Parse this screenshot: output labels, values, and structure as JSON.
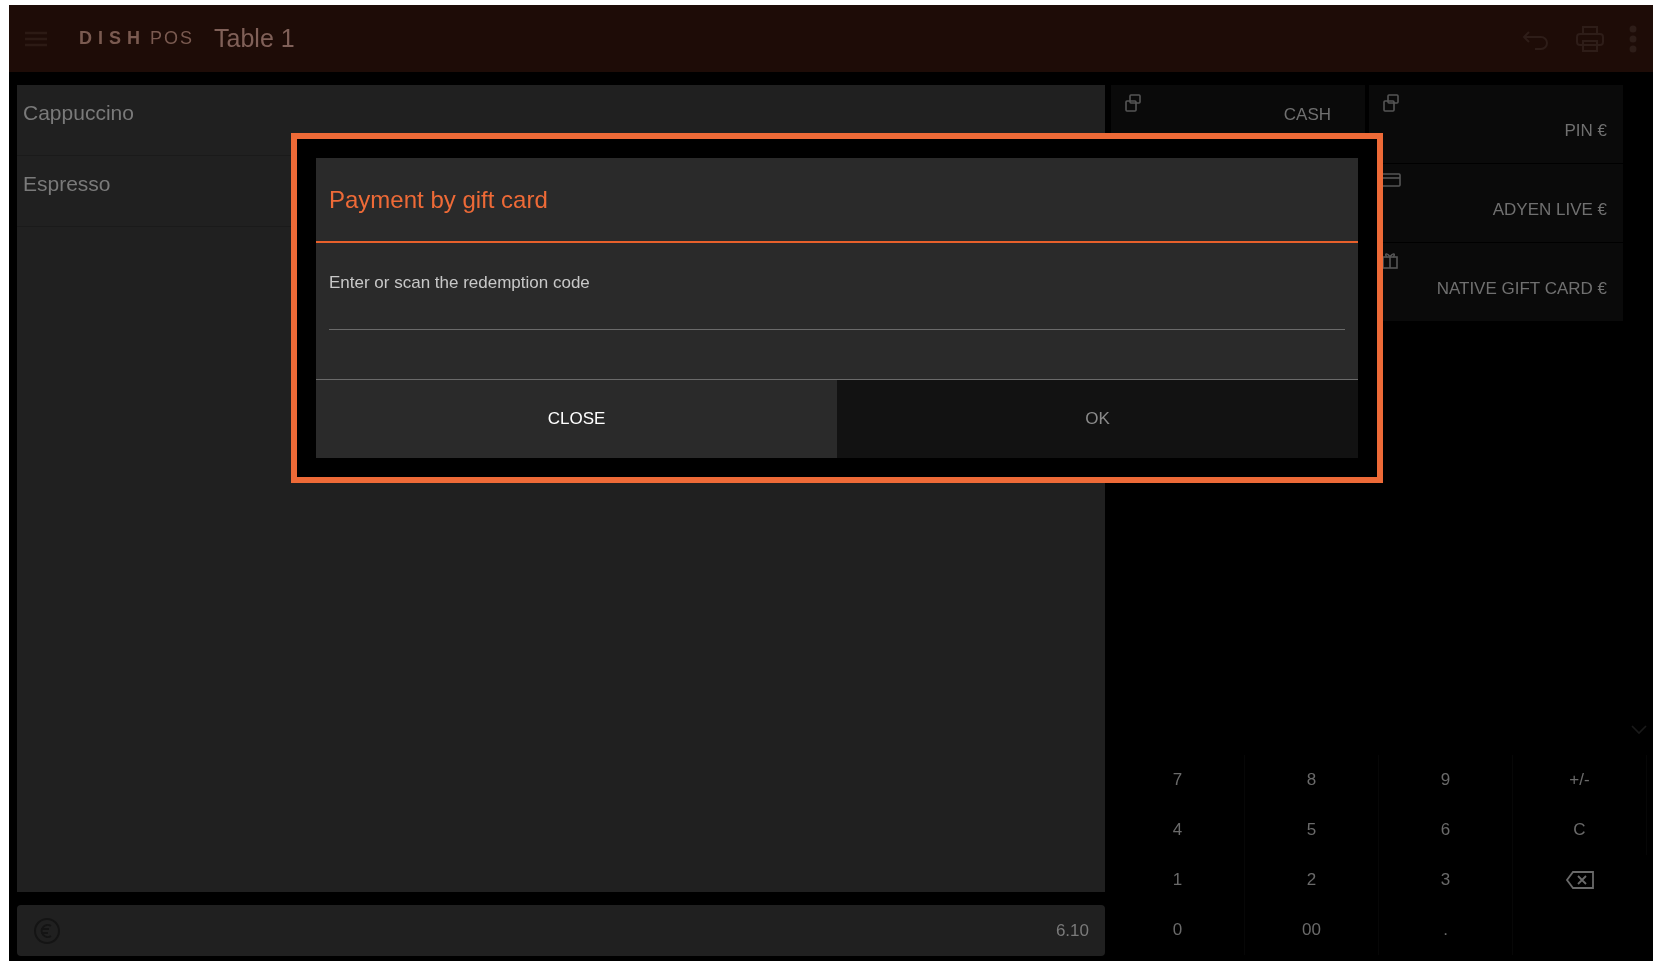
{
  "app_bar": {
    "brand": "DISH",
    "brand_suffix": "POS",
    "title": "Table 1"
  },
  "order_items": [
    {
      "name": "Cappuccino"
    },
    {
      "name": "Espresso"
    }
  ],
  "total": {
    "amount": "6.10"
  },
  "payment_methods": [
    {
      "label": "CASH"
    },
    {
      "label": "PIN €"
    },
    {
      "label": "ADYEN LIVE €"
    },
    {
      "label": "NATIVE GIFT CARD €"
    }
  ],
  "keypad": [
    {
      "kind": "text",
      "label": "7"
    },
    {
      "kind": "text",
      "label": "8"
    },
    {
      "kind": "text",
      "label": "9"
    },
    {
      "kind": "text",
      "label": "+/-"
    },
    {
      "kind": "text",
      "label": "4"
    },
    {
      "kind": "text",
      "label": "5"
    },
    {
      "kind": "text",
      "label": "6"
    },
    {
      "kind": "text",
      "label": "C"
    },
    {
      "kind": "text",
      "label": "1"
    },
    {
      "kind": "text",
      "label": "2"
    },
    {
      "kind": "text",
      "label": "3"
    },
    {
      "kind": "backspace"
    },
    {
      "kind": "text",
      "label": "0"
    },
    {
      "kind": "text",
      "label": "00"
    },
    {
      "kind": "text",
      "label": "."
    },
    {
      "kind": "empty"
    }
  ],
  "dialog": {
    "title": "Payment by gift card",
    "field_label": "Enter or scan the redemption code",
    "buttons": [
      {
        "label": "CLOSE",
        "disabled": false
      },
      {
        "label": "OK",
        "disabled": true
      }
    ]
  }
}
